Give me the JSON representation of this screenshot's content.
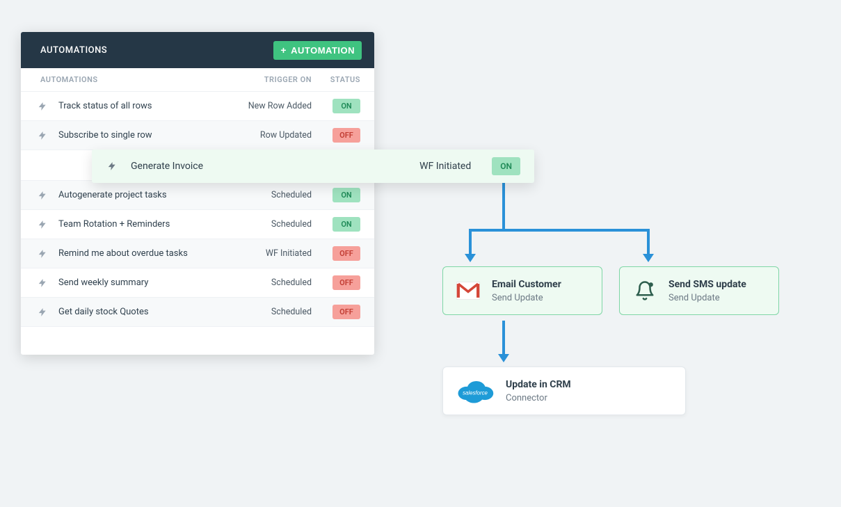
{
  "panel": {
    "title": "AUTOMATIONS",
    "add_button": "AUTOMATION",
    "headers": {
      "automations": "AUTOMATIONS",
      "trigger": "TRIGGER ON",
      "status": "STATUS"
    },
    "rows": [
      {
        "name": "Track status of all rows",
        "trigger": "New Row Added",
        "status": "ON"
      },
      {
        "name": "Subscribe to single row",
        "trigger": "Row Updated",
        "status": "OFF"
      },
      {
        "name": "Autogenerate project tasks",
        "trigger": "Scheduled",
        "status": "ON"
      },
      {
        "name": "Team Rotation + Reminders",
        "trigger": "Scheduled",
        "status": "ON"
      },
      {
        "name": "Remind me about overdue tasks",
        "trigger": "WF Initiated",
        "status": "OFF"
      },
      {
        "name": "Send weekly summary",
        "trigger": "Scheduled",
        "status": "OFF"
      },
      {
        "name": "Get daily stock Quotes",
        "trigger": "Scheduled",
        "status": "OFF"
      }
    ]
  },
  "popout": {
    "name": "Generate Invoice",
    "trigger": "WF Initiated",
    "status": "ON"
  },
  "flow": {
    "email": {
      "title": "Email Customer",
      "sub": "Send Update",
      "icon": "gmail-icon"
    },
    "sms": {
      "title": "Send SMS update",
      "sub": "Send Update",
      "icon": "bell-icon"
    },
    "crm": {
      "title": "Update in CRM",
      "sub": "Connector",
      "icon": "salesforce-icon"
    }
  },
  "colors": {
    "accent_green": "#3fc380",
    "connector_blue": "#2a91d8",
    "header_bg": "#253746"
  }
}
